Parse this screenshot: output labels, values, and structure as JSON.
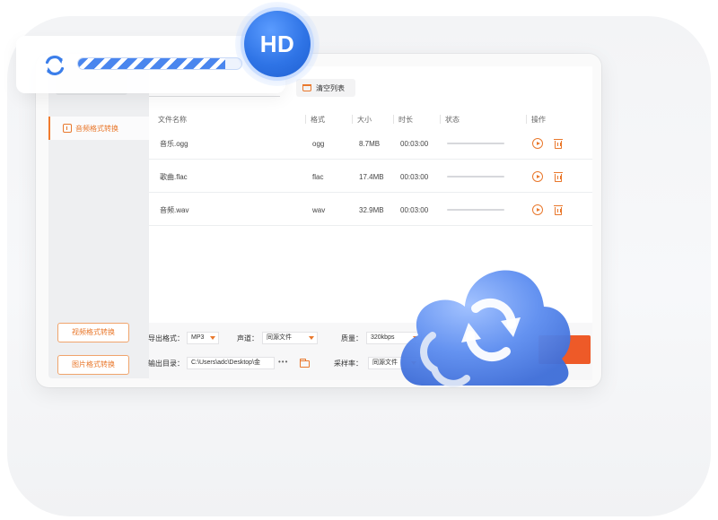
{
  "sidebar": {
    "active_item": "音频格式转换",
    "buttons": [
      "视频格式转换",
      "图片格式转换"
    ]
  },
  "toolbar": {
    "separator": "⋮",
    "clear_list": "清空列表"
  },
  "table": {
    "columns": [
      "文件名称",
      "格式",
      "大小",
      "时长",
      "状态",
      "操作"
    ],
    "rows": [
      {
        "name": "音乐.ogg",
        "format": "ogg",
        "size": "8.7MB",
        "duration": "00:03:00"
      },
      {
        "name": "歌曲.flac",
        "format": "flac",
        "size": "17.4MB",
        "duration": "00:03:00"
      },
      {
        "name": "音频.wav",
        "format": "wav",
        "size": "32.9MB",
        "duration": "00:03:00"
      }
    ]
  },
  "bottom": {
    "export_format_label": "导出格式：",
    "export_format": "MP3",
    "channel_label": "声道：",
    "channel": "同源文件",
    "quality_label": "质量：",
    "quality": "320kbps",
    "output_dir_label": "输出目录：",
    "output_dir": "C:\\Users\\adc\\Desktop\\金",
    "more": "•••",
    "sample_rate_label": "采样率：",
    "sample_rate": "同源文件"
  },
  "overlay": {
    "hd_badge": "HD",
    "progress": 0.9
  },
  "colors": {
    "accent": "#e9782c",
    "brand_blue": "#2f74e6",
    "start_button": "#ee5a28"
  },
  "icons": [
    "refresh-icon",
    "hd-badge",
    "audio-file-icon",
    "basket-icon",
    "play-icon",
    "trash-icon",
    "chevron-down-icon",
    "folder-icon",
    "cloud-sync-icon"
  ]
}
